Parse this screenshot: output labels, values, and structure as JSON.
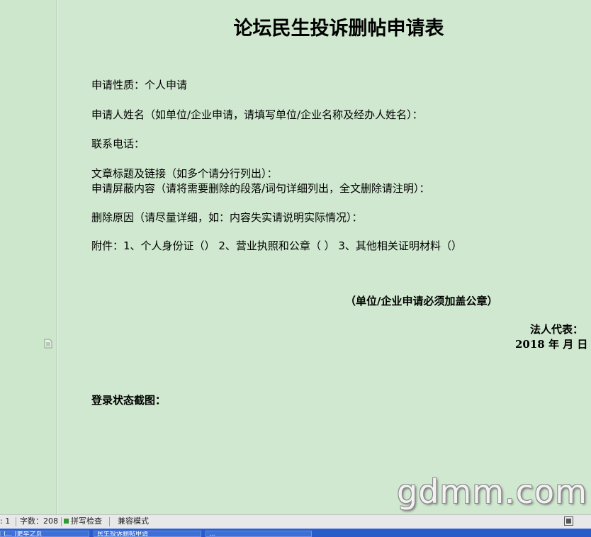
{
  "document": {
    "title": "论坛民生投诉删帖申请表",
    "lines": [
      "申请性质：个人申请",
      "申请人姓名（如单位/企业申请，请填写单位/企业名称及经办人姓名）：",
      "联系电话：",
      "文章标题及链接（如多个请分行列出）：",
      "申请屏蔽内容（请将需要删除的段落/词句详细列出，全文删除请注明）：",
      "删除原因（请尽量详细，如：内容失实请说明实际情况）：",
      "附件：1、个人身份证（）  2、营业执照和公章（  ）  3、其他相关证明材料（）"
    ],
    "seal_note": "（单位/企业申请必须加盖公章）",
    "legal_rep": "法人代表：",
    "date_line": "2018 年  月  日",
    "screenshot_label": "登录状态截图："
  },
  "watermark": "gdmm.com",
  "statusbar": {
    "page_fragment": ": 1",
    "word_count": "字数：208",
    "spell_check": "拼写检查",
    "compat_mode": "兼容模式"
  },
  "taskbar": {
    "tasks": [
      "(... )更早之页",
      "民生投诉删帖申请",
      "..."
    ]
  },
  "colors": {
    "page_background": "#cfe8cf",
    "statusbar": "#e8e8e8",
    "taskbar": "#2a5cc8",
    "spell_ok": "#2e9b2e"
  }
}
